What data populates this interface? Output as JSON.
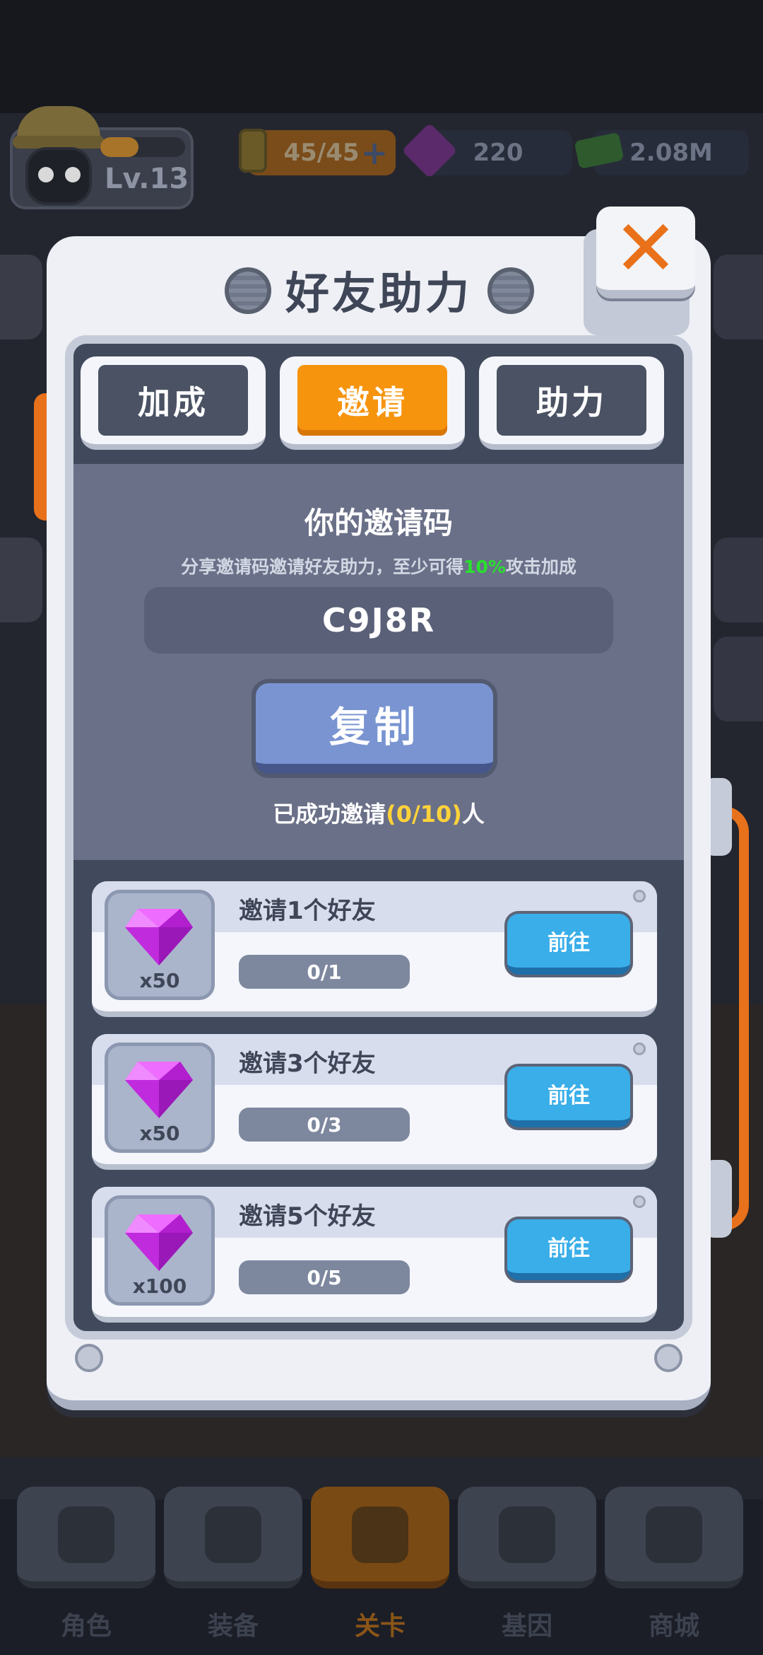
{
  "hud": {
    "level": "Lv.13",
    "level_progress": 0.45,
    "energy": "45/45",
    "gems": "220",
    "cash": "2.08M"
  },
  "modal": {
    "title": "好友助力",
    "close_label": "✕",
    "tabs": [
      {
        "label": "加成",
        "active": false
      },
      {
        "label": "邀请",
        "active": true
      },
      {
        "label": "助力",
        "active": false
      }
    ],
    "invite": {
      "title": "你的邀请码",
      "desc_before": "分享邀请码邀请好友助力，至少可得",
      "desc_highlight": "10%",
      "desc_after": "攻击加成",
      "code": "C9J8R",
      "copy_label": "复制",
      "count_before": "已成功邀请",
      "count_highlight": "(0/10)",
      "count_after": "人"
    },
    "rewards": [
      {
        "title": "邀请1个好友",
        "qty": "x50",
        "progress": "0/1",
        "progress_value": 0,
        "button": "前往"
      },
      {
        "title": "邀请3个好友",
        "qty": "x50",
        "progress": "0/3",
        "progress_value": 0,
        "button": "前往"
      },
      {
        "title": "邀请5个好友",
        "qty": "x100",
        "progress": "0/5",
        "progress_value": 0,
        "button": "前往"
      }
    ]
  },
  "bottom_nav": [
    {
      "label": "角色",
      "icon": "skull-icon",
      "active": false
    },
    {
      "label": "装备",
      "icon": "gun-icon",
      "active": false
    },
    {
      "label": "关卡",
      "icon": "map-pin-icon",
      "active": true
    },
    {
      "label": "基因",
      "icon": "hexagon-icon",
      "active": false
    },
    {
      "label": "商城",
      "icon": "shop-icon",
      "active": false
    }
  ],
  "colors": {
    "accent_orange": "#f6940e",
    "highlight_green": "#29e02f",
    "highlight_yellow": "#ffd23a",
    "button_blue": "#3aaee9",
    "gem_purple": "#d13ce8"
  }
}
